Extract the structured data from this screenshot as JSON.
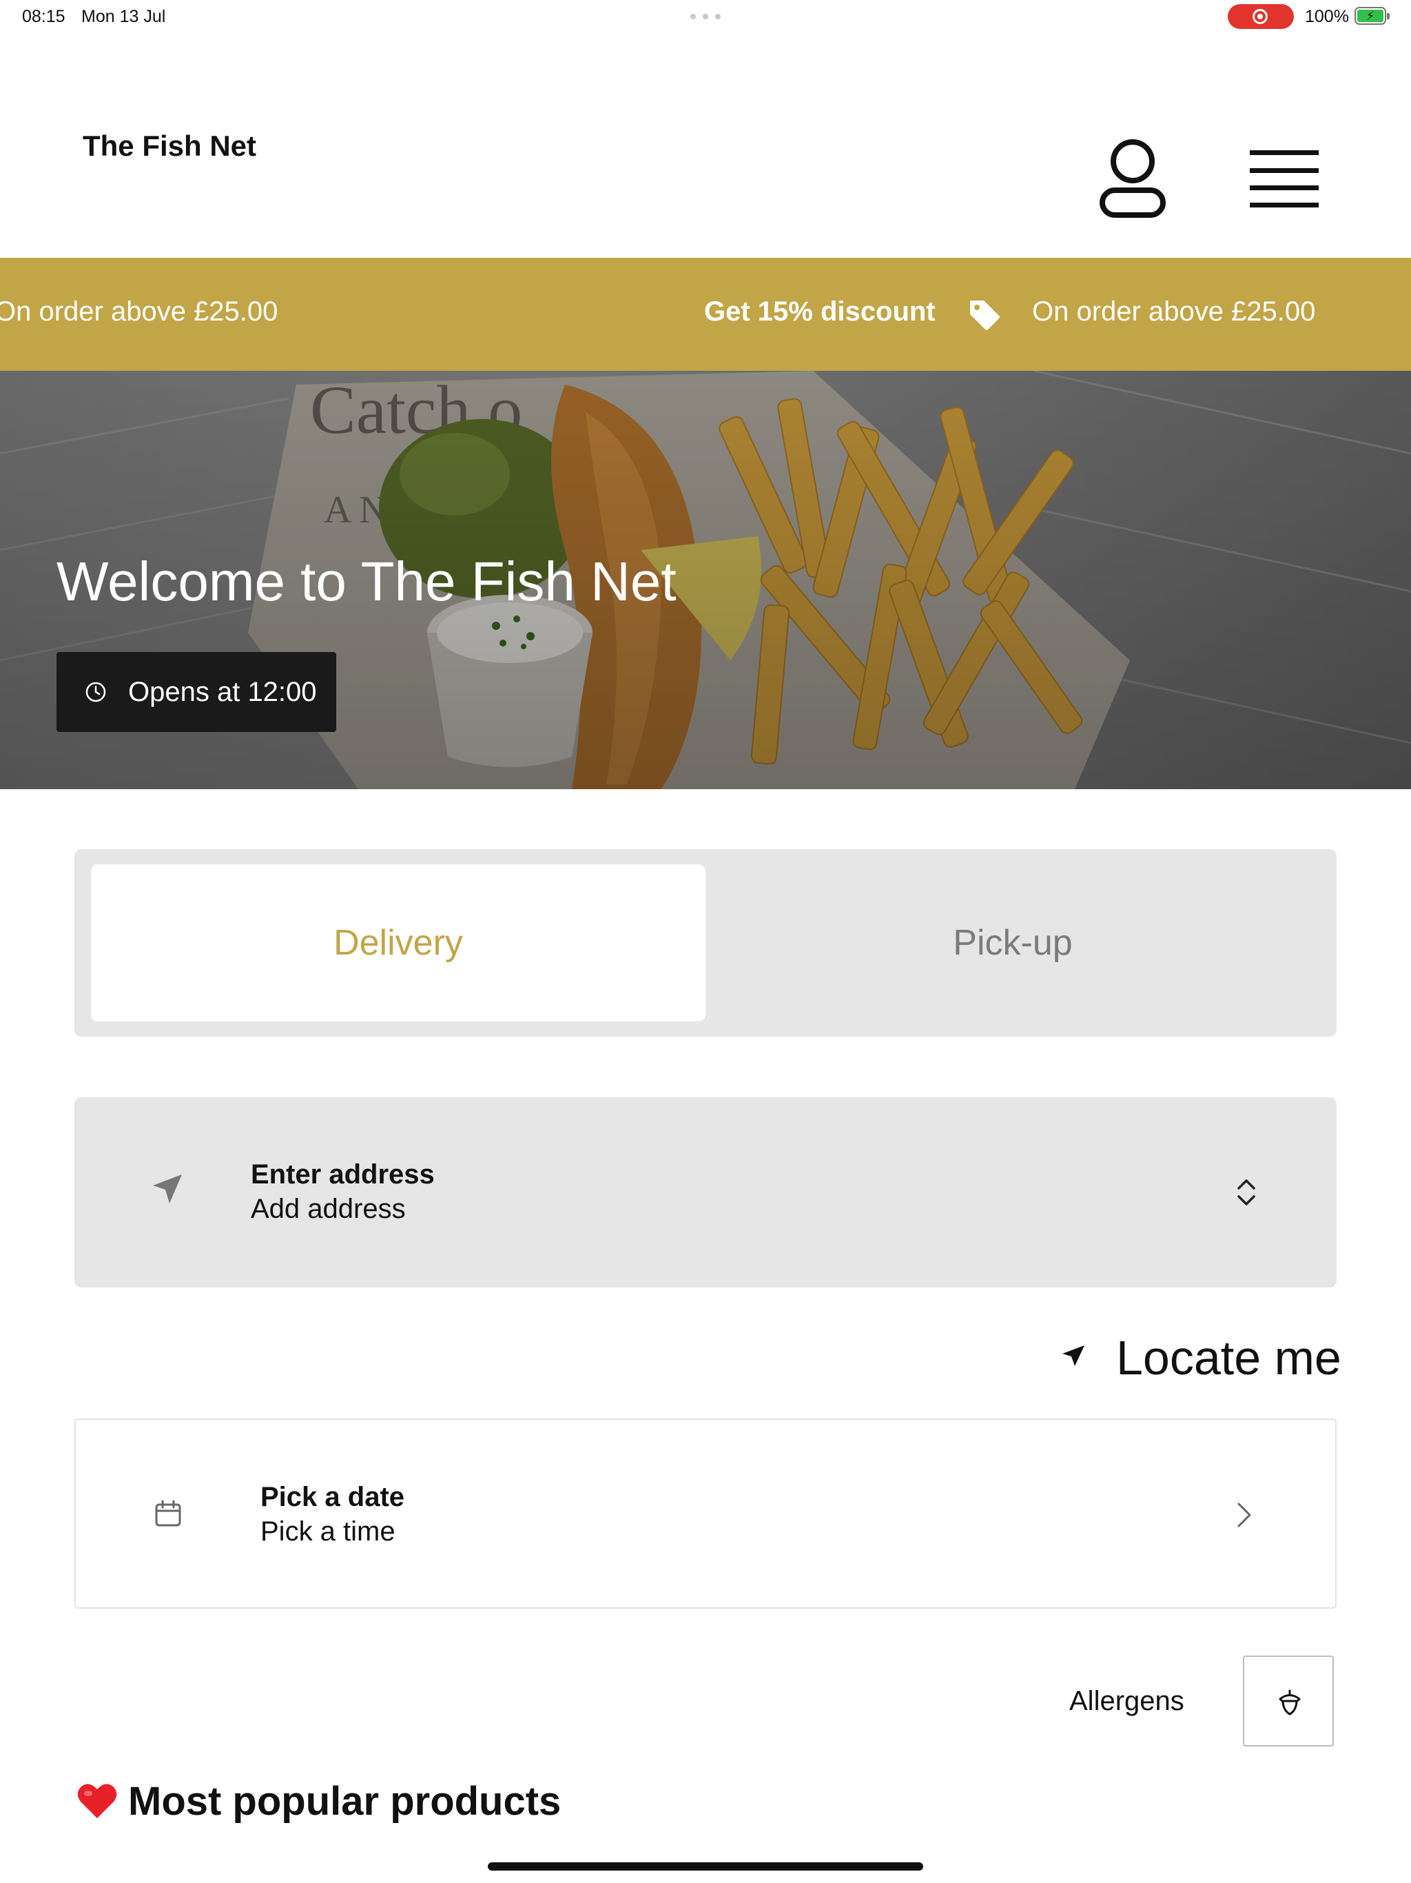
{
  "status_bar": {
    "time": "08:15",
    "date": "Mon 13 Jul",
    "battery": "100%"
  },
  "header": {
    "brand": "The Fish Net",
    "account_icon": "user-icon",
    "menu_icon": "hamburger-menu-icon"
  },
  "promo": {
    "left_text": "On order above £25.00",
    "discount": "Get 15% discount",
    "right_text": "On order above £25.00",
    "background": "#c2a547",
    "icon": "tag-icon"
  },
  "hero": {
    "title": "Welcome to The Fish Net",
    "opening": "Opens at 12:00"
  },
  "order_mode": {
    "tabs": [
      {
        "label": "Delivery",
        "selected": true
      },
      {
        "label": "Pick-up",
        "selected": false
      }
    ],
    "accent": "#c2a547"
  },
  "address": {
    "title": "Enter address",
    "value": "Add address"
  },
  "locate": {
    "label": "Locate me"
  },
  "schedule": {
    "date_label": "Pick a date",
    "time_label": "Pick a time"
  },
  "allergens": {
    "label": "Allergens"
  },
  "section": {
    "title": "Most popular products"
  }
}
